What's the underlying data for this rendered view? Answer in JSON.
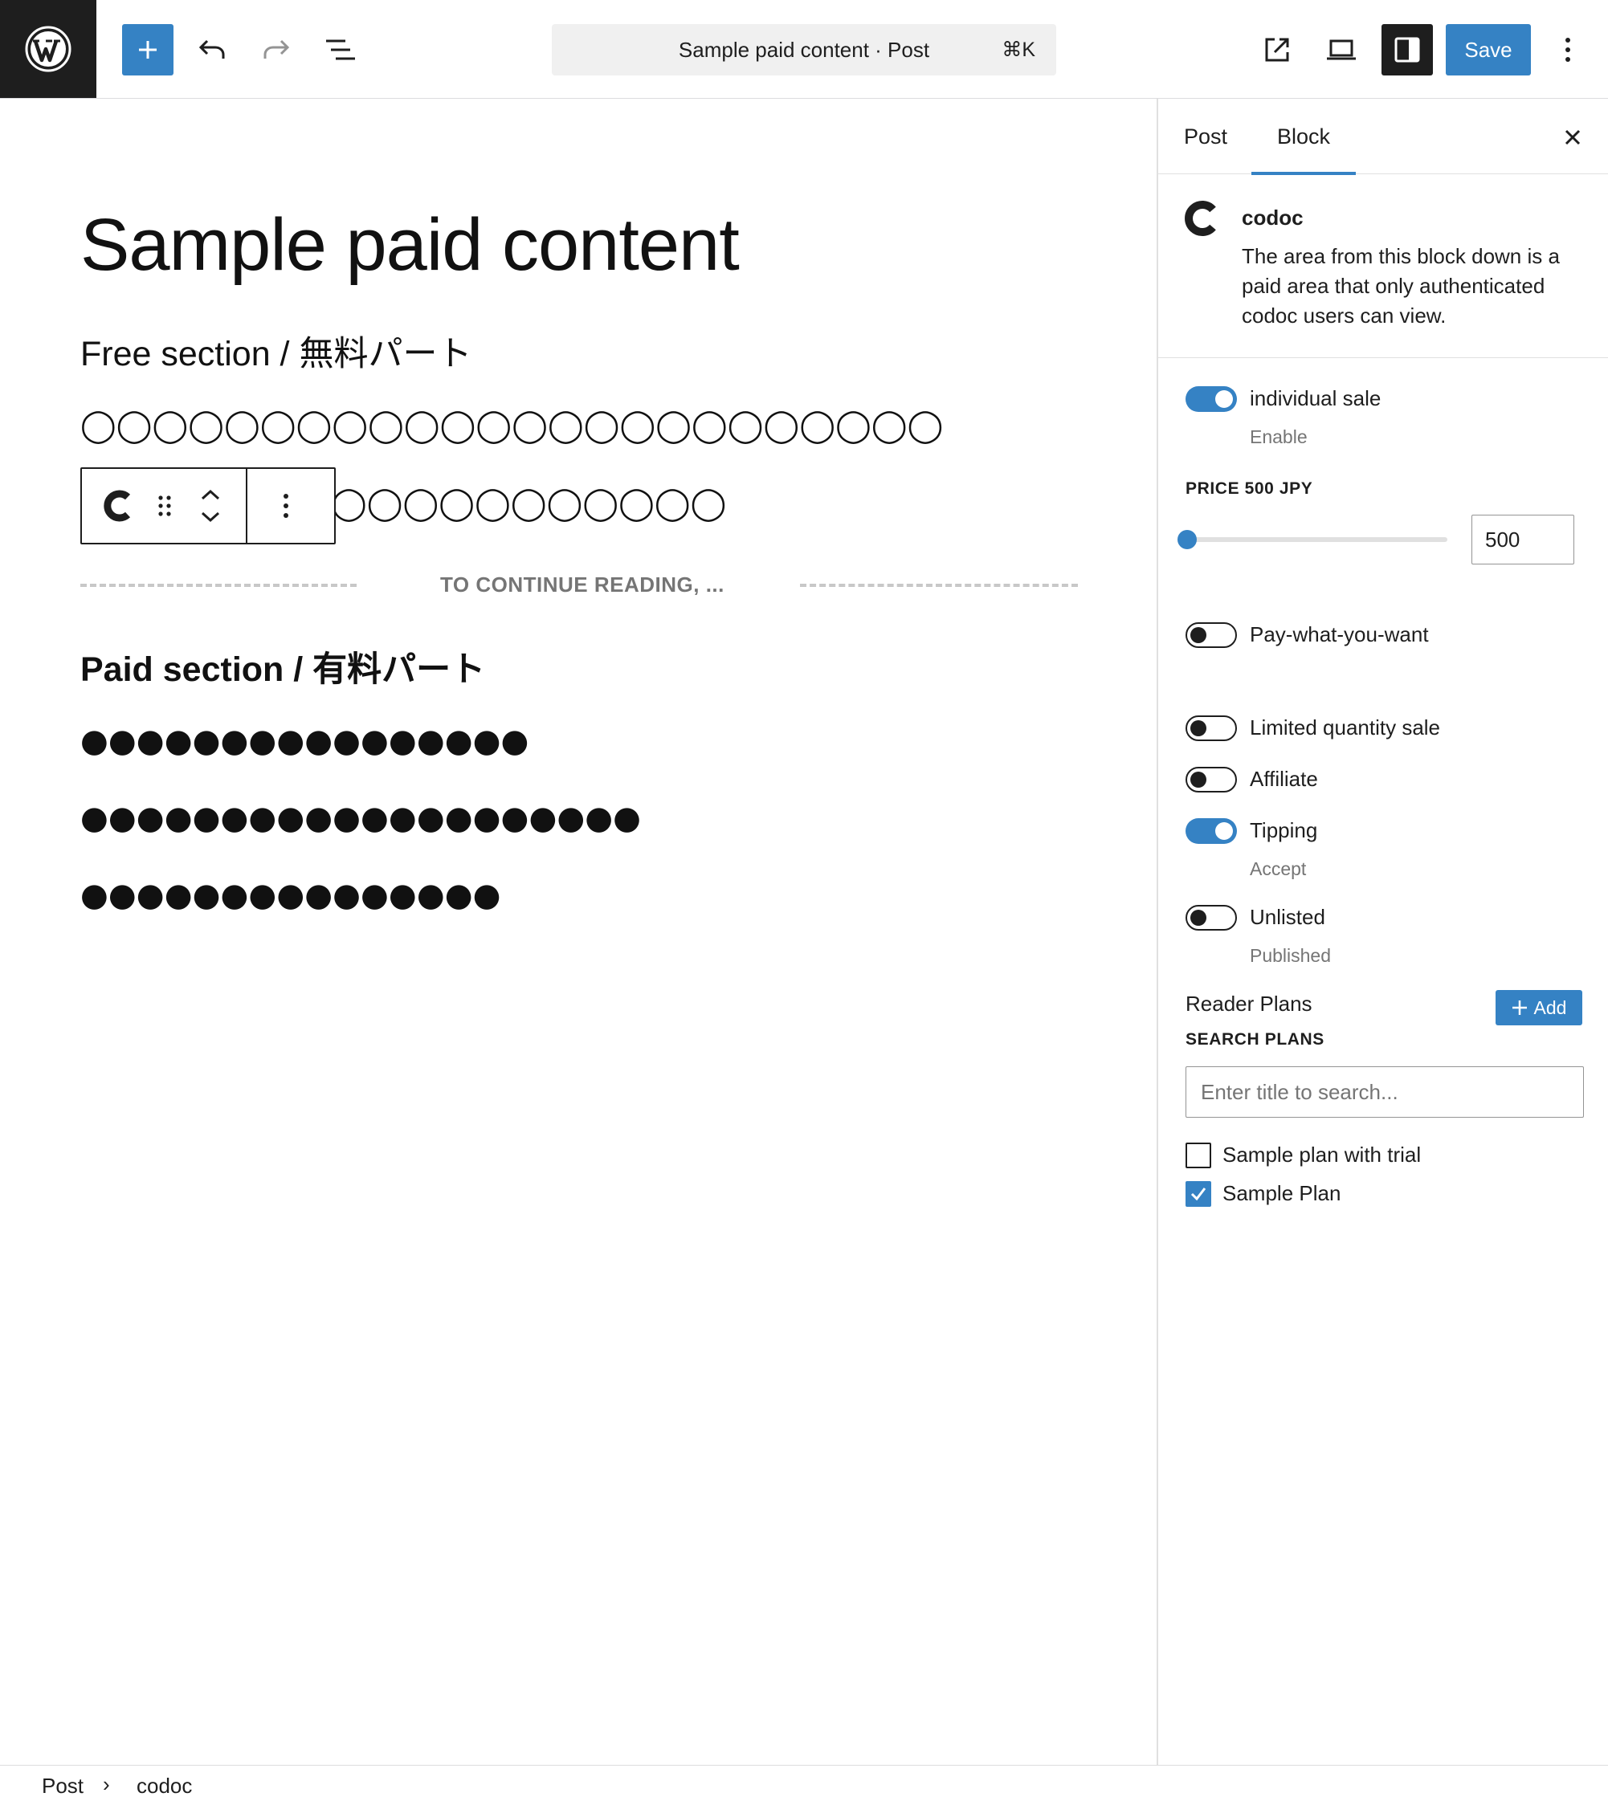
{
  "header": {
    "command_title": "Sample paid content · Post",
    "command_shortcut": "⌘K",
    "save_label": "Save"
  },
  "editor": {
    "title": "Sample paid content",
    "free_heading": "Free section / 無料パート",
    "free_lines": [
      "◯◯◯◯◯◯◯◯◯◯◯◯◯◯◯◯◯◯◯◯◯◯◯◯",
      "◯◯◯◯◯◯◯◯◯◯◯"
    ],
    "more_text": "TO CONTINUE READING, ...",
    "paid_heading": "Paid section / 有料パート",
    "paid_lines": [
      "●●●●●●●●●●●●●●●●",
      "●●●●●●●●●●●●●●●●●●●●",
      "●●●●●●●●●●●●●●●"
    ]
  },
  "sidebar": {
    "tab_post": "Post",
    "tab_block": "Block",
    "block_name": "codoc",
    "block_description": "The area from this block down is a paid area that only authenticated codoc users can view.",
    "individual_sale": {
      "label": "individual sale",
      "help": "Enable",
      "on": true
    },
    "price": {
      "label": "PRICE 500 JPY",
      "value": "500",
      "fraction": 0.0
    },
    "pay_what_you_want": {
      "label": "Pay-what-you-want",
      "on": false
    },
    "limited_quantity": {
      "label": "Limited quantity sale",
      "on": false
    },
    "affiliate": {
      "label": "Affiliate",
      "on": false
    },
    "tipping": {
      "label": "Tipping",
      "help": "Accept",
      "on": true
    },
    "unlisted": {
      "label": "Unlisted",
      "help": "Published",
      "on": false
    },
    "reader_plans": {
      "title": "Reader Plans",
      "add_label": "Add",
      "search_label": "SEARCH PLANS",
      "search_placeholder": "Enter title to search...",
      "plans": [
        {
          "label": "Sample plan with trial",
          "checked": false
        },
        {
          "label": "Sample Plan",
          "checked": true
        }
      ]
    }
  },
  "footer": {
    "crumb_post": "Post",
    "crumb_block": "codoc"
  },
  "colors": {
    "accent": "#3582c4",
    "dark": "#1e1e1e",
    "muted": "#757575"
  }
}
